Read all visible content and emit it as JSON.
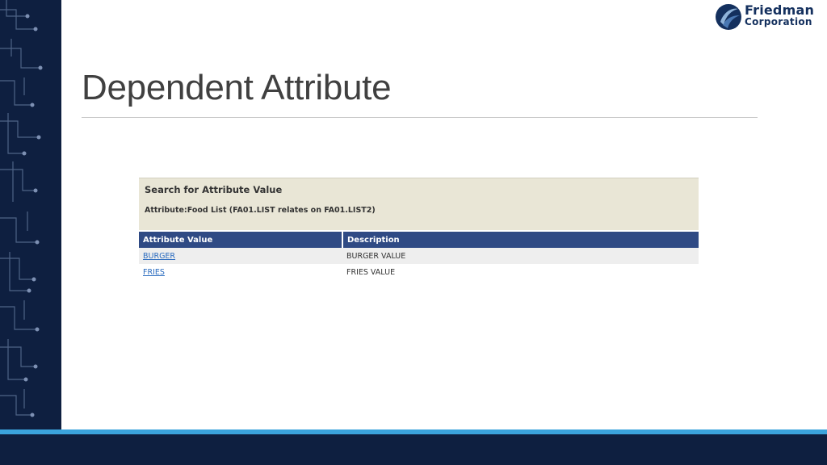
{
  "logo": {
    "line1": "Friedman",
    "line2": "Corporation"
  },
  "slide": {
    "title": "Dependent Attribute"
  },
  "search_panel": {
    "heading": "Search for Attribute Value",
    "subheading": "Attribute:Food List (FA01.LIST relates on FA01.LIST2)"
  },
  "table": {
    "columns": [
      "Attribute Value",
      "Description"
    ],
    "rows": [
      {
        "value": "BURGER",
        "description": "BURGER VALUE"
      },
      {
        "value": "FRIES",
        "description": "FRIES VALUE"
      }
    ]
  },
  "colors": {
    "sidebar": "#0e1f40",
    "accent_stripe": "#3ba3dc",
    "table_header": "#2f4a84",
    "search_panel_bg": "#e9e6d6",
    "link": "#2a6bbf"
  }
}
